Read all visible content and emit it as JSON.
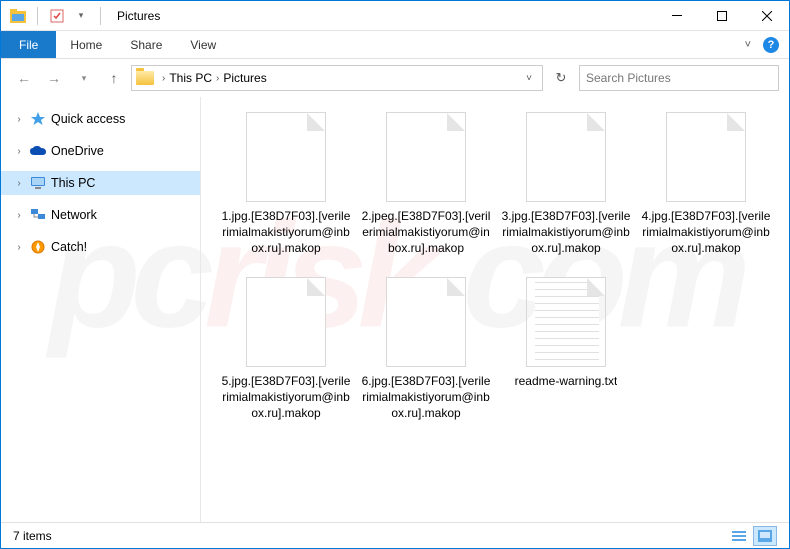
{
  "title": "Pictures",
  "ribbon": {
    "file": "File",
    "tabs": [
      "Home",
      "Share",
      "View"
    ]
  },
  "breadcrumb": {
    "items": [
      "This PC",
      "Pictures"
    ]
  },
  "search": {
    "placeholder": "Search Pictures"
  },
  "sidebar": {
    "quick_access": "Quick access",
    "onedrive": "OneDrive",
    "this_pc": "This PC",
    "network": "Network",
    "catch": "Catch!"
  },
  "files": [
    {
      "name": "1.jpg.[E38D7F03].[verilerimialmakistiyorum@inbox.ru].makop",
      "type": "blank"
    },
    {
      "name": "2.jpeg.[E38D7F03].[verilerimialmakistiyorum@inbox.ru].makop",
      "type": "blank"
    },
    {
      "name": "3.jpg.[E38D7F03].[verilerimialmakistiyorum@inbox.ru].makop",
      "type": "blank"
    },
    {
      "name": "4.jpg.[E38D7F03].[verilerimialmakistiyorum@inbox.ru].makop",
      "type": "blank"
    },
    {
      "name": "5.jpg.[E38D7F03].[verilerimialmakistiyorum@inbox.ru].makop",
      "type": "blank"
    },
    {
      "name": "6.jpg.[E38D7F03].[verilerimialmakistiyorum@inbox.ru].makop",
      "type": "blank"
    },
    {
      "name": "readme-warning.txt",
      "type": "txt"
    }
  ],
  "status": {
    "count": "7 items"
  },
  "watermark": {
    "pc": "pc",
    "risk": "risk",
    "suffix": ".com"
  }
}
